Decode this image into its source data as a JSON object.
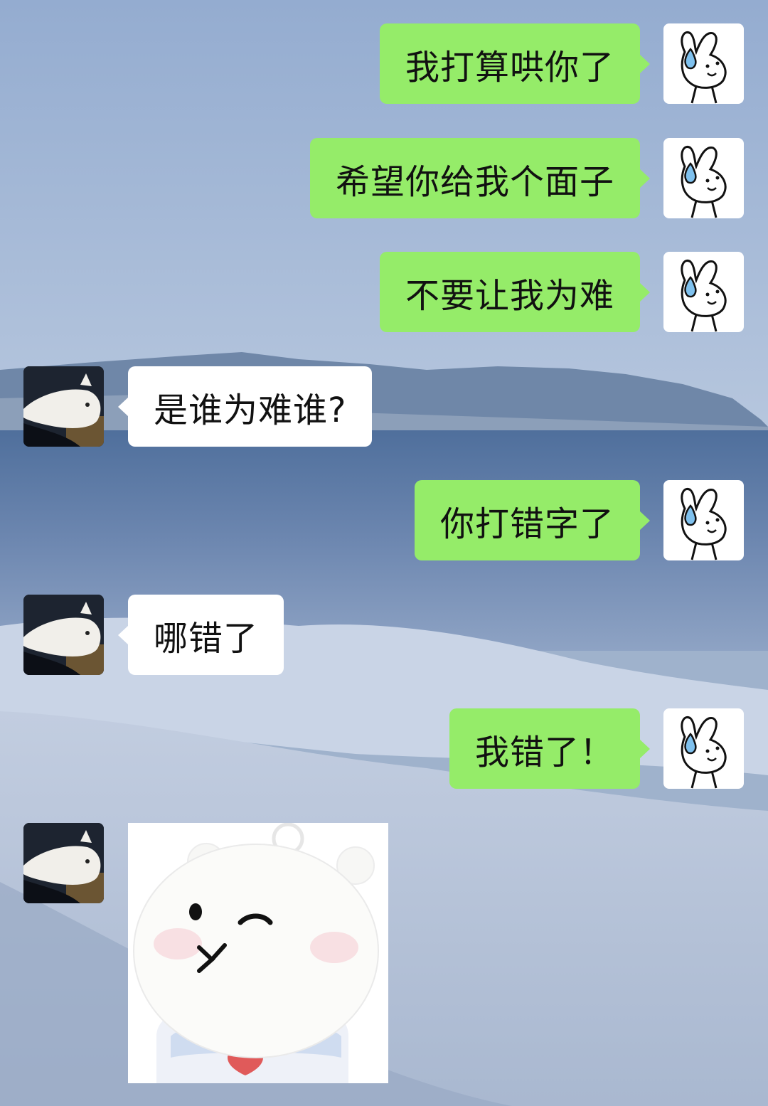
{
  "chat": {
    "messages": [
      {
        "sender": "me",
        "text": "我打算哄你了"
      },
      {
        "sender": "me",
        "text": "希望你给我个面子"
      },
      {
        "sender": "me",
        "text": "不要让我为难"
      },
      {
        "sender": "other",
        "text": "是谁为难谁?"
      },
      {
        "sender": "me",
        "text": "你打错字了"
      },
      {
        "sender": "other",
        "text": "哪错了"
      },
      {
        "sender": "me",
        "text": "我错了！"
      },
      {
        "sender": "other",
        "type": "sticker",
        "sticker": "white-bear-sticker"
      }
    ]
  },
  "avatars": {
    "me": "bunny-sweat-drop-icon",
    "other": "white-cat-photo"
  },
  "colors": {
    "my_bubble": "#95ec69",
    "their_bubble": "#ffffff"
  }
}
